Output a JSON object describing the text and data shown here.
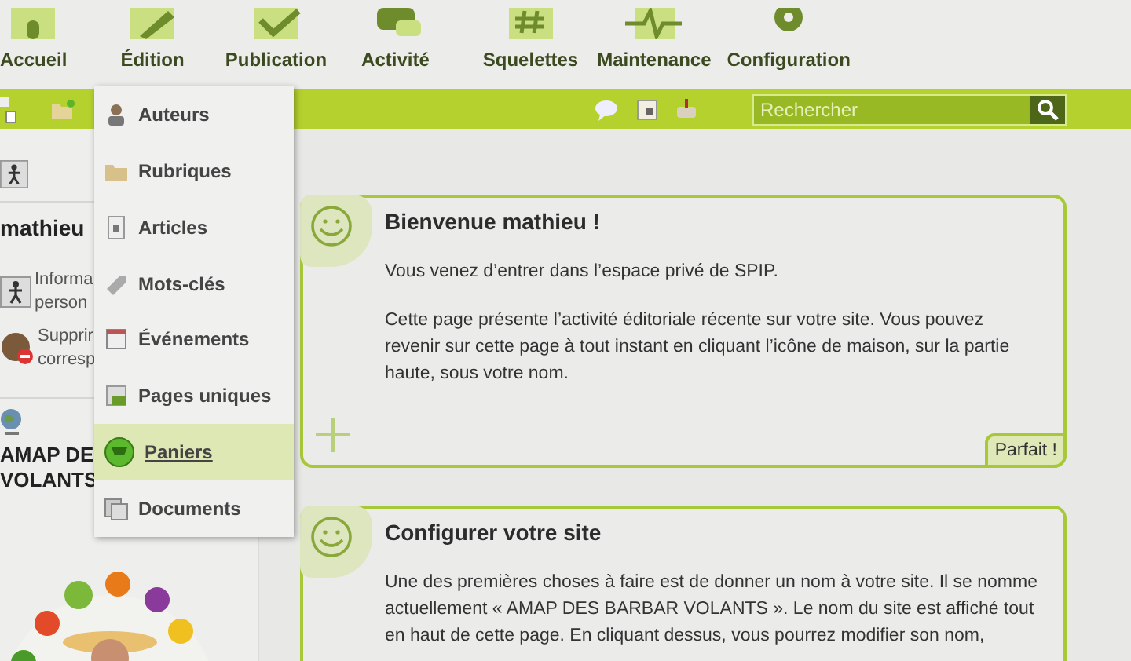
{
  "nav": [
    {
      "label": "Accueil"
    },
    {
      "label": "Édition"
    },
    {
      "label": "Publication"
    },
    {
      "label": "Activité"
    },
    {
      "label": "Squelettes"
    },
    {
      "label": "Maintenance"
    },
    {
      "label": "Configuration"
    }
  ],
  "search": {
    "placeholder": "Rechercher"
  },
  "menu": [
    {
      "label": "Auteurs",
      "selected": false
    },
    {
      "label": "Rubriques",
      "selected": false
    },
    {
      "label": "Articles",
      "selected": false
    },
    {
      "label": "Mots-clés",
      "selected": false
    },
    {
      "label": "Événements",
      "selected": false
    },
    {
      "label": "Pages uniques",
      "selected": false
    },
    {
      "label": "Paniers",
      "selected": true
    },
    {
      "label": "Documents",
      "selected": false
    }
  ],
  "sidebar": {
    "user_name": "mathieu",
    "links": [
      {
        "lines": [
          "Informa",
          "person"
        ]
      },
      {
        "lines": [
          "Supprir",
          "corresp"
        ]
      }
    ],
    "site_name": [
      "AMAP DE",
      "VOLANTS"
    ]
  },
  "cards": [
    {
      "title": "Bienvenue mathieu !",
      "paragraphs": [
        "Vous venez d’entrer dans l’espace privé de SPIP.",
        "Cette page présente l’activité éditoriale récente sur votre site. Vous pouvez revenir sur cette page à tout instant en cliquant l’icône de maison, sur la partie haute, sous votre nom."
      ],
      "button": "Parfait !"
    },
    {
      "title": "Configurer votre site",
      "paragraphs": [
        "Une des premières choses à faire est de donner un nom à votre site. Il se nomme actuellement « AMAP DES BARBAR VOLANTS ». Le nom du site est affiché tout en haut de cette page. En cliquant dessus, vous pourrez modifier son nom,"
      ]
    }
  ]
}
